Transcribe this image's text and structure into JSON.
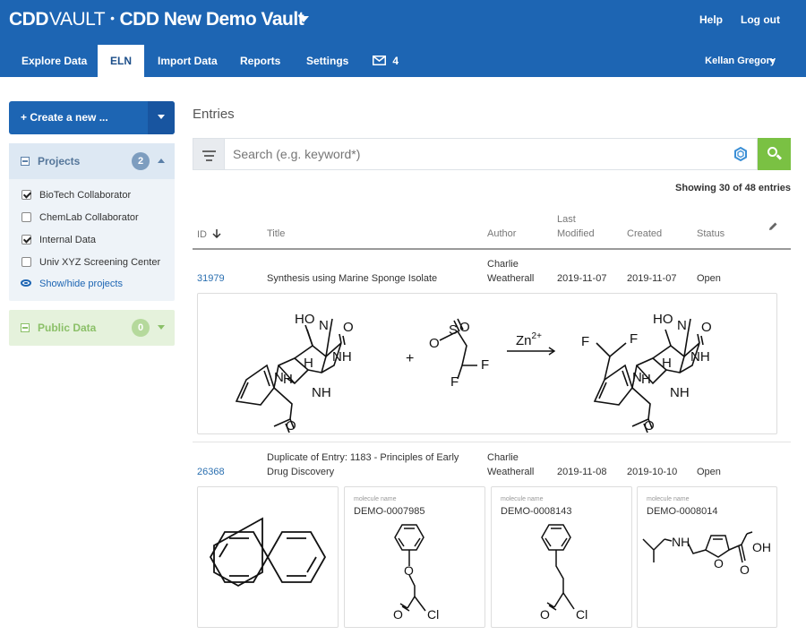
{
  "header": {
    "logo": "CDD",
    "logo_suffix": "VAULT",
    "logo_separator": "•",
    "vault_name": "CDD New Demo Vault",
    "help": "Help",
    "logout": "Log out",
    "user": "Kellan Gregory",
    "tabs": [
      {
        "label": "Explore Data"
      },
      {
        "label": "ELN"
      },
      {
        "label": "Import Data"
      },
      {
        "label": "Reports"
      },
      {
        "label": "Settings"
      }
    ],
    "messages_count": "4",
    "active_tab": "ELN"
  },
  "sidebar": {
    "create_label": "+ Create a new ...",
    "projects": {
      "title": "Projects",
      "count": "2",
      "items": [
        {
          "label": "BioTech Collaborator",
          "checked": true
        },
        {
          "label": "ChemLab Collaborator",
          "checked": false
        },
        {
          "label": "Internal Data",
          "checked": true
        },
        {
          "label": "Univ XYZ Screening Center",
          "checked": false
        }
      ],
      "show_hide": "Show/hide projects"
    },
    "public": {
      "title": "Public Data",
      "count": "0"
    }
  },
  "main": {
    "title": "Entries",
    "search_placeholder": "Search (e.g. keyword*)",
    "showing": "Showing 30 of 48 entries",
    "columns": {
      "id": "ID",
      "title": "Title",
      "author": "Author",
      "last_modified_1": "Last",
      "last_modified_2": "Modified",
      "created": "Created",
      "status": "Status"
    },
    "entries": [
      {
        "id": "31979",
        "title": "Synthesis using Marine Sponge Isolate",
        "author_first": "Charlie",
        "author_last": "Weatherall",
        "modified": "2019-11-07",
        "created": "2019-11-07",
        "status": "Open",
        "reaction": {
          "catalyst": "Zn",
          "catalyst_charge": "2+"
        }
      },
      {
        "id": "26368",
        "title_line1": "Duplicate of Entry: 1183 - Principles of Early",
        "title_line2": "Drug Discovery",
        "author_first": "Charlie",
        "author_last": "Weatherall",
        "modified": "2019-11-08",
        "created": "2019-10-10",
        "status": "Open",
        "molecules": [
          {
            "label": "molecule name",
            "name": "DEMO-0007985"
          },
          {
            "label": "molecule name",
            "name": "DEMO-0008143"
          },
          {
            "label": "molecule name",
            "name": "DEMO-0008014"
          }
        ]
      }
    ]
  },
  "colors": {
    "header_bg": "#1d65b3",
    "search_button": "#7ac143",
    "link": "#2a6fb0"
  },
  "icons": [
    "chevron-down-icon",
    "mail-icon",
    "filter-icon",
    "search-icon",
    "hexagon-structure-icon",
    "pencil-icon",
    "sort-arrow-icon",
    "eye-icon",
    "checkbox-icon"
  ]
}
